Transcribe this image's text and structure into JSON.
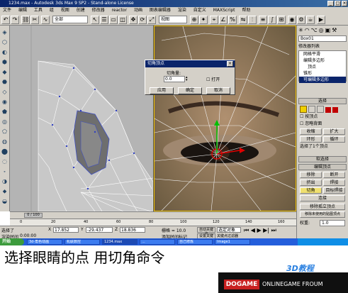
{
  "window": {
    "title": "1234.max - Autodesk 3ds Max 9 SP2 - Stand-alone License",
    "min": "_",
    "max": "□",
    "close": "×"
  },
  "menubar": [
    "文件",
    "编辑",
    "工具",
    "组",
    "视图",
    "创建",
    "修改器",
    "reactor",
    "动画",
    "图表编辑器",
    "渲染",
    "自定义",
    "MAXScript",
    "帮助"
  ],
  "toolbar": {
    "select_filter": "全部",
    "ref_coord": "视图"
  },
  "command_panel": {
    "object_name": "Box01",
    "modifier_list_label": "修改器列表",
    "stack": [
      "网格平滑",
      "编辑多边形",
      "顶点",
      "锥形",
      "可编辑多边形"
    ],
    "rollout_select": "选择",
    "by_vertex": "按顶点",
    "ignore_backfacing": "忽略背面",
    "shrink": "收缩",
    "grow": "扩大",
    "ring": "环形",
    "loop": "循环",
    "selected_status": "选择了1个顶点",
    "rollout_soft": "软选择",
    "rollout_edit_vertices": "编辑顶点",
    "remove": "移除",
    "break": "断开",
    "extrude": "挤出",
    "weld": "焊接",
    "chamfer": "切角",
    "target_weld": "目标焊接",
    "connect": "连接",
    "remove_isolated": "移除孤立顶点",
    "remove_unused_map": "移除未使用的贴图顶点",
    "weight_label": "权重:",
    "weight_value": "1.0"
  },
  "dialog": {
    "title": "切角顶点",
    "amount_label": "切角量:",
    "amount_value": "0.0",
    "open_label": "打开",
    "apply": "应用",
    "ok": "确定",
    "cancel": "取消"
  },
  "timeline": {
    "frame": "0 / 100",
    "ticks": [
      "0",
      "20",
      "40",
      "60",
      "80",
      "100",
      "120",
      "140",
      "160"
    ]
  },
  "status": {
    "selected_label": "选择了",
    "x_label": "X",
    "x_value": "17.852",
    "y_label": "Y",
    "y_value": "-29.437",
    "z_label": "Z",
    "z_value": "18.836",
    "grid": "栅格 = 10.0",
    "autokey": "自动关键点",
    "selected_obj": "选定对象",
    "setkey": "设置关键点",
    "keyfilter": "关键点过滤器",
    "add_time_tag": "添加时间标记",
    "time_value": "0:00:00",
    "clock_label": "渲染时间"
  },
  "taskbar": {
    "start": "开始",
    "tasks": [
      "3d-角色动画",
      "机联数控",
      "1234.max",
      "...",
      "自己修炼",
      "Image1"
    ]
  },
  "caption": "选择眼睛的点  用切角命令",
  "footer": {
    "brand": "DOGAME",
    "site": "ONLINEGAME FROUM",
    "watermark": "3D教程"
  }
}
